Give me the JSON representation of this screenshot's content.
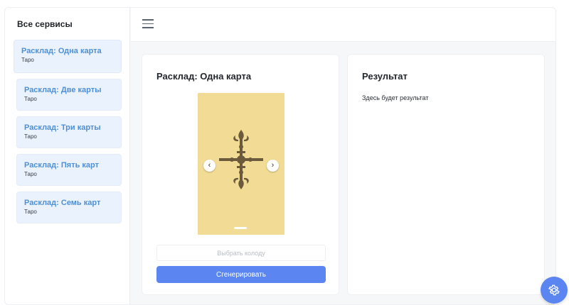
{
  "sidebar": {
    "title": "Все сервисы",
    "items": [
      {
        "label": "Расклад: Одна карта",
        "subtitle": "Таро",
        "active": true
      },
      {
        "label": "Расклад: Две карты",
        "subtitle": "Таро"
      },
      {
        "label": "Расклад: Три карты",
        "subtitle": "Таро"
      },
      {
        "label": "Расклад: Пять карт",
        "subtitle": "Таро"
      },
      {
        "label": "Расклад: Семь карт",
        "subtitle": "Таро"
      }
    ]
  },
  "topbar": {
    "menu_icon": "hamburger-menu-icon"
  },
  "spread_panel": {
    "title": "Расклад: Одна карта",
    "card_back_color": "#f2dc95",
    "carousel": {
      "prev_icon": "chevron-left-icon",
      "next_icon": "chevron-right-icon"
    },
    "deck_select": {
      "placeholder": "Выбрать колоду",
      "value": ""
    },
    "generate_label": "Сгенерировать"
  },
  "result_panel": {
    "title": "Результат",
    "text": "Здесь будет результат"
  },
  "settings_fab": {
    "icon": "gear-icon"
  },
  "colors": {
    "accent": "#5b86f2",
    "link": "#4f8fd6",
    "item_bg": "#eaf2fd"
  }
}
